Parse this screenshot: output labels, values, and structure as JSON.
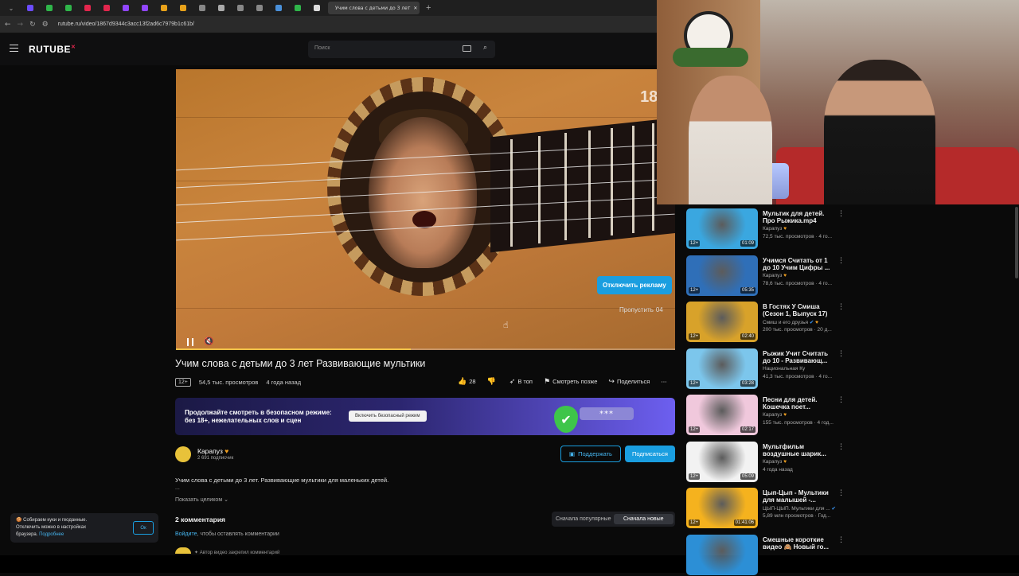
{
  "browser": {
    "active_tab_title": "Учим слова с детьми до 3 лет",
    "url": "rutube.ru/video/1867d9344c3acc13f2ad6c7979b1c61b/",
    "tab_colors": [
      "#6b4cff",
      "#2fb54a",
      "#2fb54a",
      "#e2264d",
      "#e2264d",
      "#9146ff",
      "#9146ff",
      "#e8a21a",
      "#e8a21a",
      "#888888",
      "#aaaaaa",
      "#888888",
      "#888888",
      "#4a90d9",
      "#2fb54a",
      "#dddddd"
    ]
  },
  "header": {
    "logo": "RUTUBE",
    "search_placeholder": "Поиск"
  },
  "player": {
    "age_overlay": "18+",
    "ad_button": "Отключить рекламу",
    "skip_label": "Пропустить",
    "skip_seconds": "04",
    "progress_fraction": 0.47
  },
  "video": {
    "title": "Учим слова с детьми до 3 лет Развивающие мультики",
    "age": "12+",
    "views": "54,5 тыс. просмотров",
    "date": "4 года назад",
    "likes": "28",
    "actions": {
      "top": "В топ",
      "later": "Смотреть позже",
      "share": "Поделиться"
    }
  },
  "banner": {
    "line1": "Продолжайте смотреть в безопасном режиме:",
    "line2": "без 18+, нежелательных слов и сцен",
    "button": "Включить безопасный режим",
    "password_mask": "***"
  },
  "channel": {
    "name": "Карапуз",
    "subscribers": "2 691 подписчик",
    "support": "Поддержать",
    "subscribe": "Подписаться"
  },
  "description": {
    "text": "Учим слова с детьми до 3 лет. Развивающие мультики для маленьких детей.",
    "ellipsis": "...",
    "show_all": "Показать целиком"
  },
  "comments": {
    "title": "2 комментария",
    "sort_popular": "Сначала популярные",
    "sort_new": "Сначала новые",
    "login_link": "Войдите",
    "login_text": ", чтобы оставлять комментарии",
    "pinned": "Автор видео закрепил комментарий"
  },
  "cookie": {
    "line1": "Собираем куки и геоданные.",
    "line2": "Отключить можно в настройках",
    "line3": "браузера.",
    "more": "Подробнее",
    "ok": "Ок"
  },
  "sidebar": [
    {
      "title": "Мультик для детей. Про Рыжика.mp4",
      "channel": "Карапуз",
      "views": "72,5 тыс. просмотров · 4 го...",
      "age": "12+",
      "duration": "01:09",
      "color": "#3aa7e0"
    },
    {
      "title": "Учимся Считать от 1 до 10 Учим Цифры ...",
      "channel": "Карапуз",
      "views": "78,6 тыс. просмотров · 4 го...",
      "age": "12+",
      "duration": "05:35",
      "color": "#2f6fb8"
    },
    {
      "title": "В Гостях У Смиша (Сезон 1, Выпуск 17)",
      "channel": "Смиш и его друзья",
      "views": "200 тыс. просмотров · 20 д...",
      "age": "12+",
      "duration": "02:40",
      "color": "#d8a22a"
    },
    {
      "title": "Рыжик Учит Считать до 10 - Развивающ...",
      "channel": "Национальная Ку",
      "views": "41,3 тыс. просмотров · 4 го...",
      "age": "12+",
      "duration": "03:28",
      "color": "#7cc6ec"
    },
    {
      "title": "Песни для детей. Кошечка поет...",
      "channel": "Карапуз",
      "views": "155 тыс. просмотров · 4 год...",
      "age": "12+",
      "duration": "02:17",
      "color": "#f0c8dc"
    },
    {
      "title": "Мультфильм воздушные шарик...",
      "channel": "Карапуз",
      "views": "4 года назад",
      "age": "12+",
      "duration": "05:09",
      "color": "#f2f2f2"
    },
    {
      "title": "Цып-Цып - Мультики для малышей -...",
      "channel": "ЦЫП-ЦЫП. Мультики для ...",
      "views": "5,89 млн просмотров · Год...",
      "age": "12+",
      "duration": "01:41:06",
      "color": "#f5b21e"
    },
    {
      "title": "Смешные короткие видео 🙈 Новый го...",
      "channel": "",
      "views": "",
      "age": "",
      "duration": "",
      "color": "#2c8fd6"
    }
  ]
}
